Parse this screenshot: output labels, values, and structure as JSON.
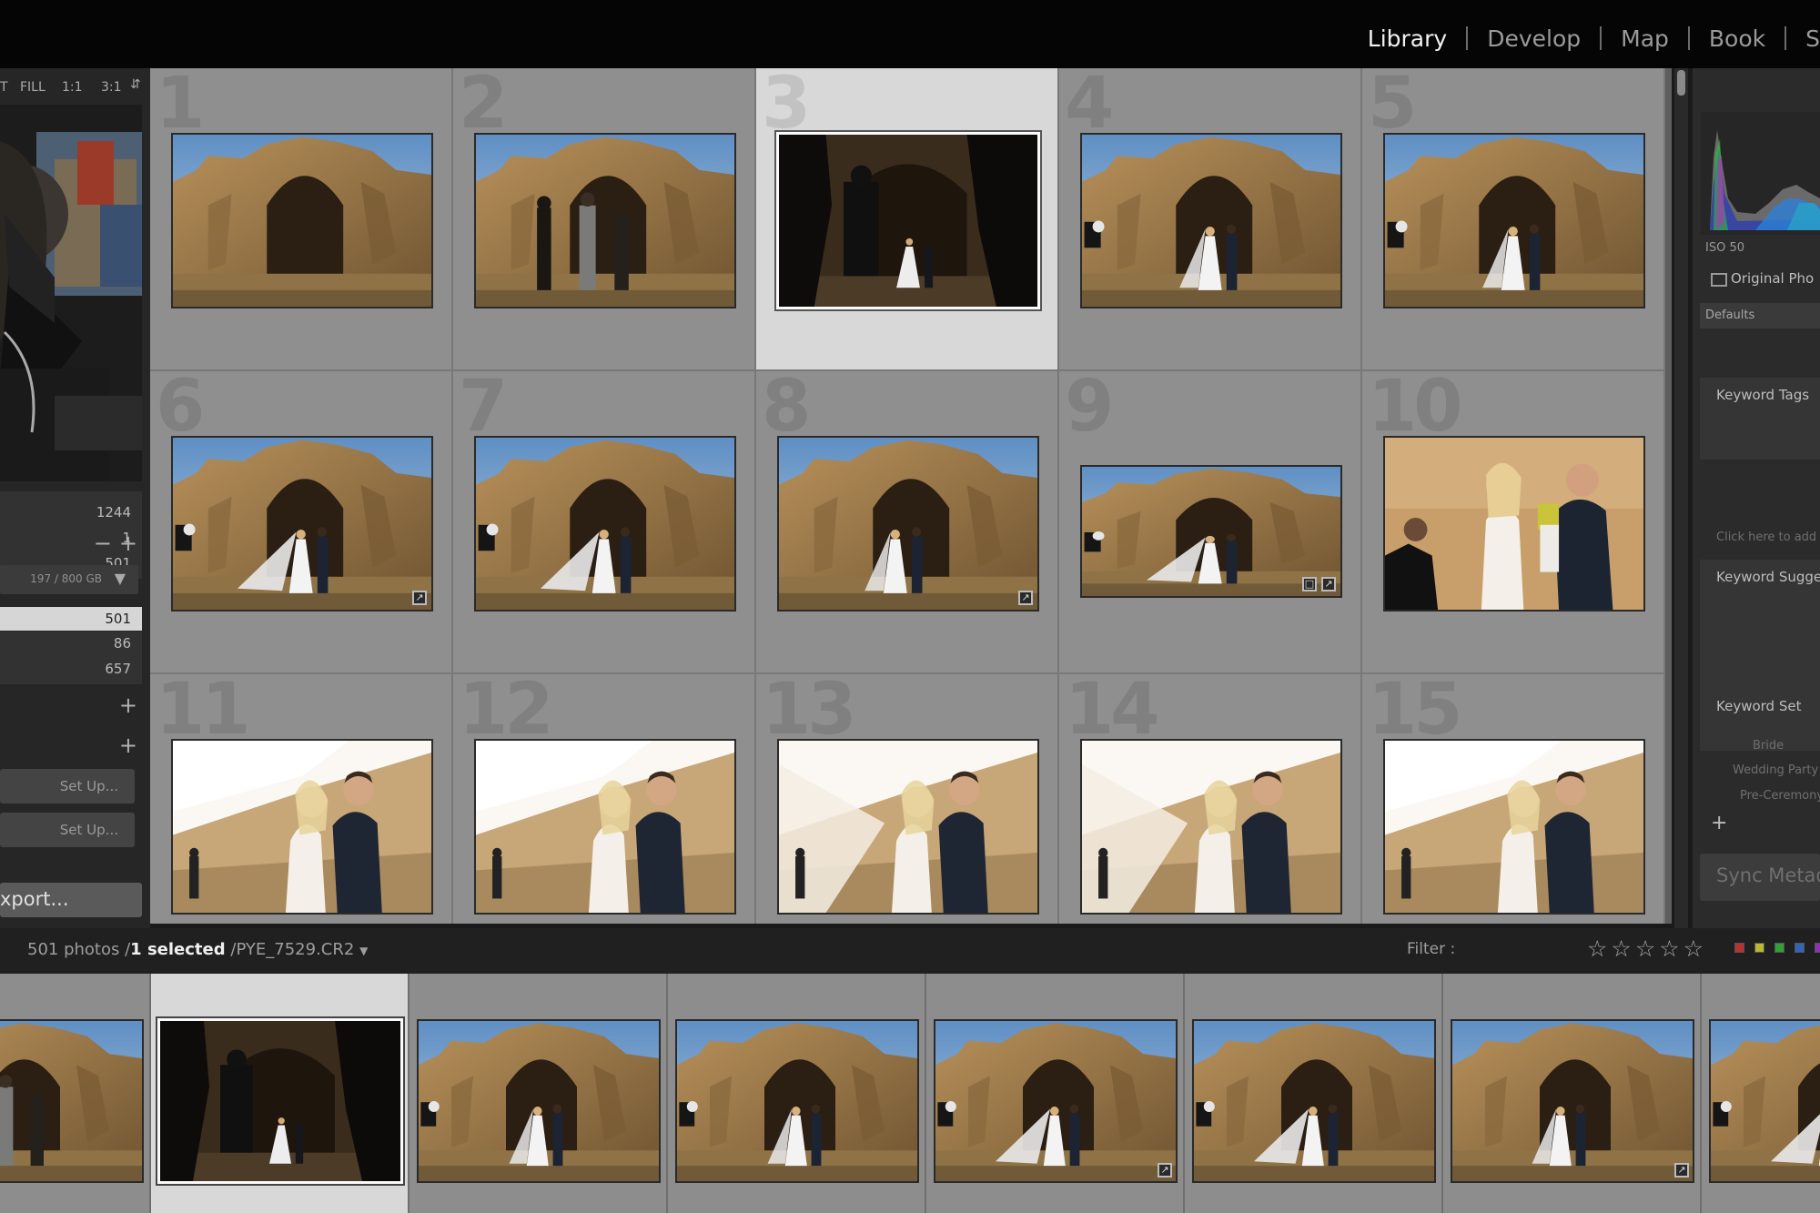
{
  "modules": {
    "library": "Library",
    "develop": "Develop",
    "map": "Map",
    "book": "Book",
    "slideshow_partial": "S"
  },
  "navigator": {
    "zoom_options": [
      "T",
      "FILL",
      "1:1",
      "3:1"
    ],
    "dropdown_icon": "updown-arrow-icon"
  },
  "catalog": {
    "counts": [
      "1244",
      "1",
      "501"
    ]
  },
  "folders": {
    "volume_label": "197 / 800 GB",
    "counts": [
      "501",
      "86",
      "657"
    ]
  },
  "publish": {
    "setup_label_1": "Set Up...",
    "setup_label_2": "Set Up..."
  },
  "export_button": "xport...",
  "grid": {
    "cells": [
      {
        "num": "1",
        "scene": "arch-empty"
      },
      {
        "num": "2",
        "scene": "arch-people"
      },
      {
        "num": "3",
        "scene": "arch-dark",
        "selected": true
      },
      {
        "num": "4",
        "scene": "arch-couple"
      },
      {
        "num": "5",
        "scene": "arch-couple"
      },
      {
        "num": "6",
        "scene": "arch-veil",
        "badge": "edit-icon"
      },
      {
        "num": "7",
        "scene": "arch-veil"
      },
      {
        "num": "8",
        "scene": "arch-couple-center",
        "badge": "edit-icon"
      },
      {
        "num": "9",
        "scene": "arch-veil",
        "wide": true,
        "badge": "crop-edit-icon"
      },
      {
        "num": "10",
        "scene": "couple-portrait"
      },
      {
        "num": "11",
        "scene": "couple-close"
      },
      {
        "num": "12",
        "scene": "couple-close"
      },
      {
        "num": "13",
        "scene": "couple-close-blur"
      },
      {
        "num": "14",
        "scene": "couple-close-blur"
      },
      {
        "num": "15",
        "scene": "couple-close"
      }
    ]
  },
  "right_panel": {
    "iso": "ISO 50",
    "original_photo": "Original Pho",
    "defaults": "Defaults",
    "keyword_tags": "Keyword Tags",
    "keyword_tags_placeholder": "Click here to add",
    "keyword_suggestions": "Keyword Sugge",
    "keyword_set": "Keyword Set",
    "keyword_set_items": [
      "Bride",
      "Wedding Party",
      "Pre-Ceremony"
    ],
    "sync_metadata": "Sync Metad"
  },
  "filter_bar": {
    "photo_count": "501 photos /",
    "selected": "1 selected",
    "filename": "/PYE_7529.CR2",
    "filter_label": "Filter :",
    "stars": "☆☆☆☆☆",
    "flag_colors": [
      "#b83232",
      "#b8b832",
      "#32a032",
      "#3264b8",
      "#8a32b8"
    ]
  },
  "filmstrip": {
    "cells": [
      {
        "scene": "arch-people",
        "partial": true
      },
      {
        "scene": "arch-dark",
        "selected": true
      },
      {
        "scene": "arch-couple"
      },
      {
        "scene": "arch-couple"
      },
      {
        "scene": "arch-veil",
        "badge": "edit-icon"
      },
      {
        "scene": "arch-veil"
      },
      {
        "scene": "arch-couple-center",
        "badge": "edit-icon"
      },
      {
        "scene": "arch-veil",
        "partial": true
      }
    ]
  }
}
